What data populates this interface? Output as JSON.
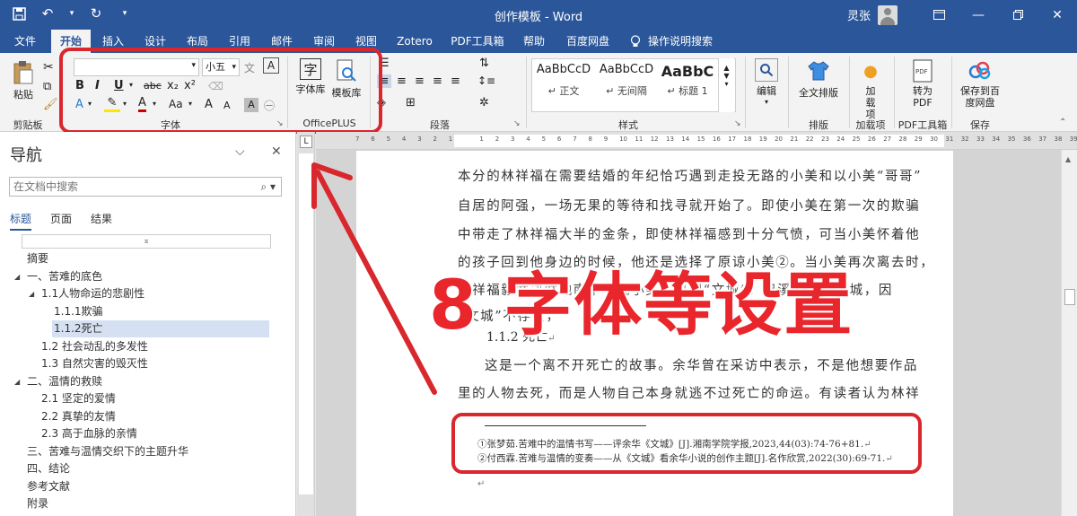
{
  "window": {
    "title": "创作模板 - Word",
    "user": "灵张",
    "icons": [
      "save-icon",
      "undo-icon",
      "redo-icon",
      "customize-icon"
    ]
  },
  "menu": {
    "items": [
      "文件",
      "开始",
      "插入",
      "设计",
      "布局",
      "引用",
      "邮件",
      "审阅",
      "视图",
      "Zotero",
      "PDF工具箱",
      "帮助",
      "百度网盘",
      "操作说明搜索"
    ],
    "active": "开始"
  },
  "ribbon": {
    "clipboard": {
      "paste": "粘贴",
      "label": "剪贴板"
    },
    "font": {
      "size": "小五",
      "label": "字体",
      "format_buttons": [
        "B",
        "I",
        "U",
        "abc",
        "x₂",
        "x²",
        "A",
        "Aa",
        "A",
        "A"
      ]
    },
    "officeplus": {
      "font_lib": "字体库",
      "template_lib": "模板库",
      "label": "OfficePLUS"
    },
    "paragraph": {
      "label": "段落"
    },
    "styles": {
      "label": "样式",
      "items": [
        {
          "sample": "AaBbCcD",
          "name": "正文"
        },
        {
          "sample": "AaBbCcD",
          "name": "无间隔"
        },
        {
          "sample": "AaBbC",
          "name": "标题 1"
        }
      ]
    },
    "editing": {
      "edit": "编辑"
    },
    "layout": {
      "full_layout": "全文排版",
      "label": "排版"
    },
    "addin": {
      "load": "加载项",
      "label": "加载项"
    },
    "pdf": {
      "convert": "转为PDF",
      "label": "PDF工具箱"
    },
    "save": {
      "save_baidu": "保存到百度网盘",
      "label": "保存"
    }
  },
  "nav": {
    "title": "导航",
    "search_placeholder": "在文档中搜索",
    "tabs": [
      "标题",
      "页面",
      "结果"
    ],
    "active_tab": "标题",
    "items": [
      {
        "text": "摘要",
        "level": 0,
        "arrow": false
      },
      {
        "text": "一、苦难的底色",
        "level": 0,
        "arrow": true
      },
      {
        "text": "1.1人物命运的悲剧性",
        "level": 1,
        "arrow": true
      },
      {
        "text": "1.1.1欺骗",
        "level": 2,
        "arrow": false
      },
      {
        "text": "1.1.2死亡",
        "level": 2,
        "arrow": false,
        "selected": true
      },
      {
        "text": "1.2 社会动乱的多发性",
        "level": 1,
        "arrow": false
      },
      {
        "text": "1.3 自然灾害的毁灭性",
        "level": 1,
        "arrow": false
      },
      {
        "text": "二、温情的救赎",
        "level": 0,
        "arrow": true
      },
      {
        "text": "2.1 坚定的爱情",
        "level": 1,
        "arrow": false
      },
      {
        "text": "2.2 真挚的友情",
        "level": 1,
        "arrow": false
      },
      {
        "text": "2.3 高于血脉的亲情",
        "level": 1,
        "arrow": false
      },
      {
        "text": "三、苦难与温情交织下的主题升华",
        "level": 0,
        "arrow": false
      },
      {
        "text": "四、结论",
        "level": 0,
        "arrow": false
      },
      {
        "text": "参考文献",
        "level": 0,
        "arrow": false
      },
      {
        "text": "附录",
        "level": 0,
        "arrow": false
      }
    ]
  },
  "document": {
    "lines": [
      "本分的林祥福在需要结婚的年纪恰巧遇到走投无路的小美和以小美“哥哥”",
      "自居的阿强，一场无果的等待和找寻就开始了。即使小美在第一次的欺骗",
      "中带走了林祥福大半的金条，即使林祥福感到十分气愤，可当小美怀着他",
      "的孩子回到他身边的时候，他还是选择了原谅小美②。当小美再次离去时，",
      "林祥福毅然决然地南下寻找小美，只因“文城”，但溪镇不是文城，因",
      "“文城”不存在，"
    ],
    "heading": "1.1.2 死亡",
    "lines2": [
      "这是一个离不开死亡的故事。余华曾在采访中表示，不是他想要作品",
      "里的人物去死，而是人物自己本身就逃不过死亡的命运。有读者认为林祥"
    ],
    "footnotes": [
      "①张梦茹.苦难中的温情书写——评余华《文城》[J].湘南学院学报,2023,44(03):74-76+81.",
      "②付西霖.苦难与温情的变奏——从《文城》看余华小说的创作主题[J].名作欣赏,2022(30):69-71."
    ]
  },
  "overlay": {
    "text": "8 字体等设置"
  },
  "colors": {
    "accent": "#2b579a",
    "annotation_red": "#d9272e",
    "selected_nav": "#d5e1f2"
  }
}
